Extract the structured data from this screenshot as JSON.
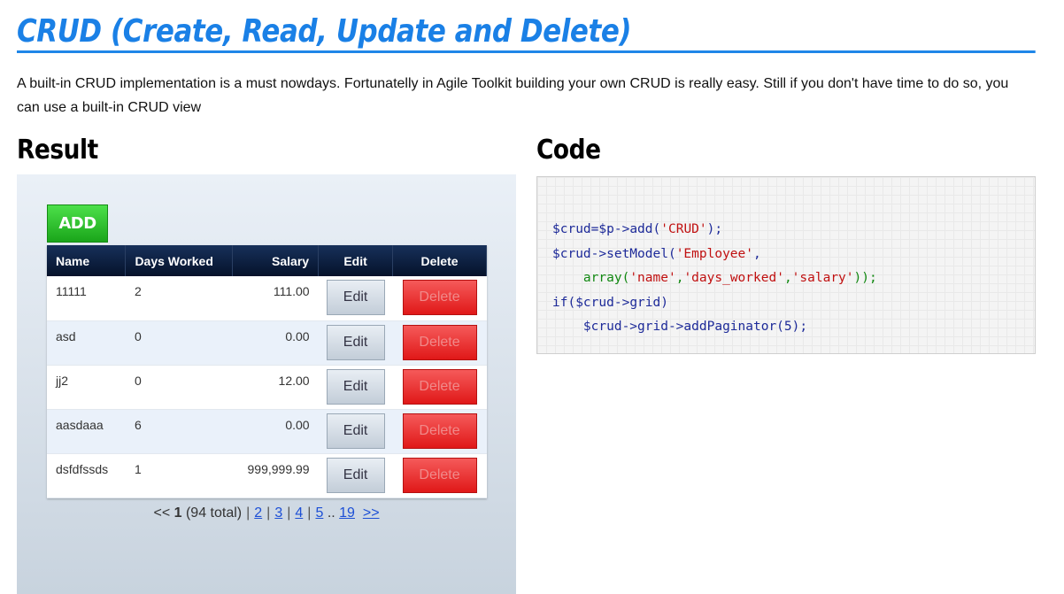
{
  "page": {
    "title": "CRUD (Create, Read, Update and Delete)",
    "intro": "A built-in CRUD implementation is a must nowdays. Fortunatelly in Agile Toolkit building your own CRUD is really easy. Still if you don't have time to do so, you can use a built-in CRUD view"
  },
  "result": {
    "heading": "Result",
    "add_label": "ADD",
    "columns": [
      "Name",
      "Days Worked",
      "Salary",
      "Edit",
      "Delete"
    ],
    "rows": [
      {
        "name": "11111",
        "days_worked": "2",
        "salary": "111.00",
        "edit": "Edit",
        "delete": "Delete"
      },
      {
        "name": "asd",
        "days_worked": "0",
        "salary": "0.00",
        "edit": "Edit",
        "delete": "Delete"
      },
      {
        "name": "jj2",
        "days_worked": "0",
        "salary": "12.00",
        "edit": "Edit",
        "delete": "Delete"
      },
      {
        "name": "aasdaaa",
        "days_worked": "6",
        "salary": "0.00",
        "edit": "Edit",
        "delete": "Delete"
      },
      {
        "name": "dsfdfssds",
        "days_worked": "1",
        "salary": "999,999.99",
        "edit": "Edit",
        "delete": "Delete"
      }
    ],
    "paginator": {
      "prev": "<<",
      "current": "1",
      "total": "(94 total)",
      "separator": "|",
      "pages": [
        "2",
        "3",
        "4",
        "5"
      ],
      "ellipsis": "..",
      "last": "19",
      "next": ">>"
    }
  },
  "code": {
    "heading": "Code",
    "line1": {
      "a": "$crud",
      "b": "=",
      "c": "$p",
      "d": "->add(",
      "e": "'CRUD'",
      "f": ");"
    },
    "line2": {
      "a": "$crud",
      "b": "->setModel(",
      "c": "'Employee'",
      "d": ","
    },
    "line3": {
      "a": "    array(",
      "b": "'name'",
      "c": ",",
      "d": "'days_worked'",
      "e": ",",
      "f": "'salary'",
      "g": "));"
    },
    "line4": {
      "a": "if(",
      "b": "$crud",
      "c": "->grid)"
    },
    "line5": {
      "a": "    $crud",
      "b": "->grid->addPaginator(",
      "c": "5",
      "d": ");"
    }
  },
  "colors": {
    "title_blue": "#1a80e6",
    "add_green": "#2cc42a",
    "delete_red": "#ea2a2a",
    "header_navy": "#0b1e40",
    "link_blue": "#1c4fd6"
  }
}
